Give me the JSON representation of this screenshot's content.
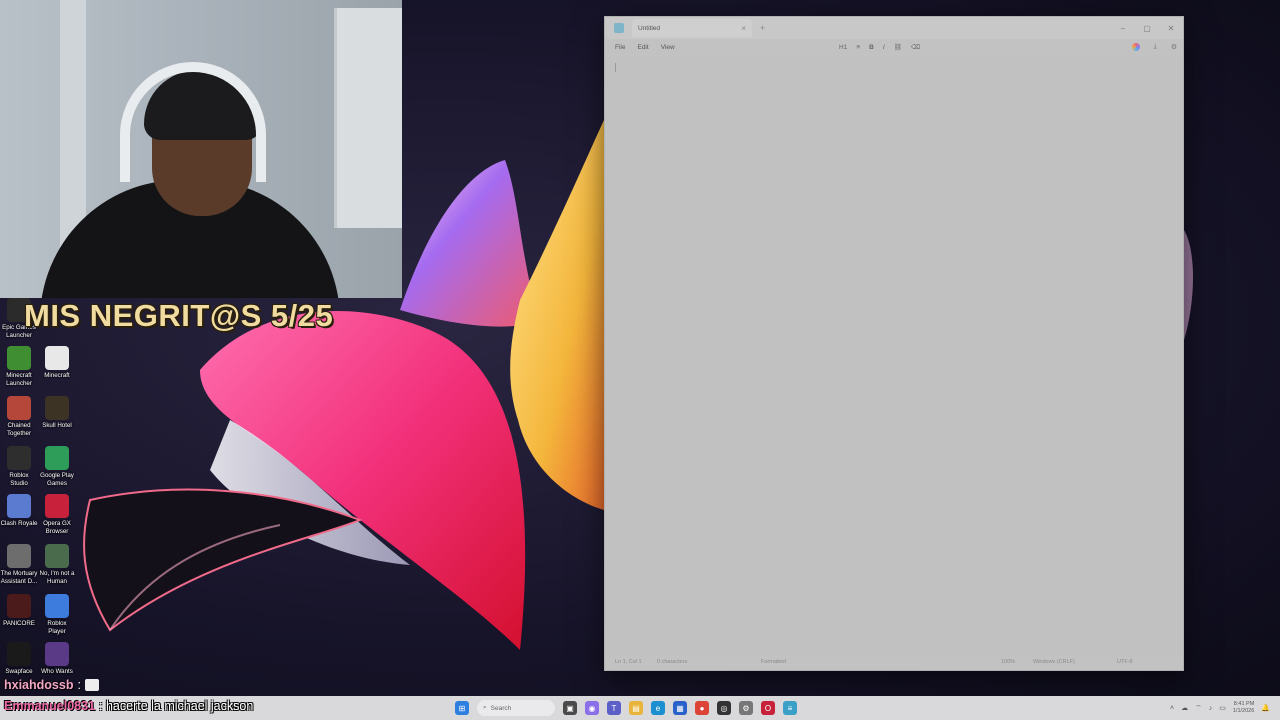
{
  "stream": {
    "overlay_title": "MIS NEGRIT@S 5/25"
  },
  "desktop": {
    "icons": [
      {
        "label": "Epic Games Launcher",
        "icon": "epic-games-icon",
        "color": "#2b2b2b"
      },
      {
        "label": "Minecraft Launcher",
        "icon": "minecraft-launcher-icon",
        "color": "#3f8f32"
      },
      {
        "label": "Minecraft",
        "icon": "file-icon",
        "color": "#e8e8e8"
      },
      {
        "label": "Chained Together",
        "icon": "chained-together-icon",
        "color": "#b5473a"
      },
      {
        "label": "Skull Hotel",
        "icon": "skull-hotel-icon",
        "color": "#3c3324"
      },
      {
        "label": "Roblox Studio",
        "icon": "roblox-studio-icon",
        "color": "#2e2e2e"
      },
      {
        "label": "Google Play Games",
        "icon": "google-play-games-icon",
        "color": "#2e9d5a"
      },
      {
        "label": "Clash Royale",
        "icon": "clash-royale-icon",
        "color": "#5a7bd0"
      },
      {
        "label": "Opera GX Browser",
        "icon": "opera-gx-icon",
        "color": "#c8213c"
      },
      {
        "label": "The Mortuary Assistant D...",
        "icon": "mortuary-assistant-icon",
        "color": "#6d6d6d"
      },
      {
        "label": "No, I'm not a Human",
        "icon": "not-a-human-icon",
        "color": "#4a6b4c"
      },
      {
        "label": "PANICORE",
        "icon": "panicore-icon",
        "color": "#4b1b1b"
      },
      {
        "label": "Roblox Player",
        "icon": "roblox-player-icon",
        "color": "#3d7bdc"
      },
      {
        "label": "Swapface",
        "icon": "swapface-icon",
        "color": "#1a1a1a"
      },
      {
        "label": "Who Wants",
        "icon": "who-wants-icon",
        "color": "#5a3a86"
      }
    ]
  },
  "editor": {
    "tab_title": "Untitled",
    "menu": [
      "File",
      "Edit",
      "View"
    ],
    "format_tools": [
      "H1",
      "≡",
      "B",
      "I",
      "⛓",
      "⌫"
    ],
    "status": {
      "position": "Ln 1, Col 1",
      "characters": "0 characters",
      "mode": "Formatted",
      "zoom": "100%",
      "line_ending": "Windows (CRLF)",
      "encoding": "UTF-8"
    }
  },
  "chat": {
    "message1_user": "hxiahdossb",
    "message1_sep": ":",
    "message2_user": "Emmanuel0831",
    "message2_text": ": hacerte la michael jackson"
  },
  "taskbar": {
    "search_placeholder": "Search",
    "time": "8:41 PM",
    "date": "1/1/2026"
  },
  "colors": {
    "window_bg": "#c2c2c2",
    "taskbar_bg": "#d9d9dc",
    "overlay_text": "#f0dca0",
    "chat_user": "#f06aa8"
  }
}
